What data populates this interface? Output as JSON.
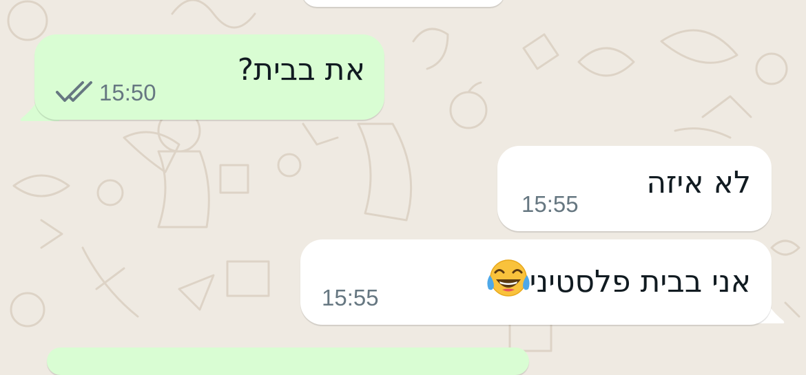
{
  "chat": {
    "messages": [
      {
        "direction": "outgoing",
        "text": "את בבית?",
        "time": "15:50",
        "status": "read"
      },
      {
        "direction": "incoming",
        "text": "לא איזה",
        "time": "15:55"
      },
      {
        "direction": "incoming",
        "text": "אני בבית פלסטיני",
        "emoji": "face-with-tears-of-joy-icon",
        "time": "15:55"
      }
    ]
  },
  "colors": {
    "outgoing_bubble": "#d9fdd3",
    "incoming_bubble": "#ffffff",
    "wallpaper": "#efeae2",
    "read_ticks": "#667781"
  }
}
